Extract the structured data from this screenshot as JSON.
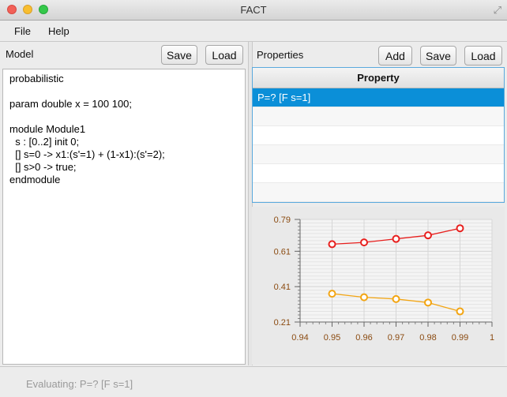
{
  "window": {
    "title": "FACT"
  },
  "menu": {
    "file": "File",
    "help": "Help"
  },
  "model": {
    "label": "Model",
    "save": "Save",
    "load": "Load",
    "code": "probabilistic\n\nparam double x = 100 100;\n\nmodule Module1\n  s : [0..2] init 0;\n  [] s=0 -> x1:(s'=1) + (1-x1):(s'=2);\n  [] s>0 -> true;\nendmodule"
  },
  "properties": {
    "label": "Properties",
    "add": "Add",
    "save": "Save",
    "load": "Load",
    "column": "Property",
    "rows": [
      "P=? [F s=1]",
      "",
      "",
      "",
      "",
      ""
    ]
  },
  "status": {
    "text": "Evaluating: P=? [F s=1]"
  },
  "chart_data": {
    "type": "line",
    "x": [
      0.95,
      0.96,
      0.97,
      0.98,
      0.99
    ],
    "series": [
      {
        "values": [
          0.65,
          0.66,
          0.68,
          0.7,
          0.74
        ],
        "color": "#e8201e"
      },
      {
        "values": [
          0.37,
          0.35,
          0.34,
          0.32,
          0.27
        ],
        "color": "#f3a512"
      }
    ],
    "xlim": [
      0.94,
      1.0
    ],
    "ylim": [
      0.21,
      0.79
    ],
    "xticks": [
      "0.94",
      "0.95",
      "0.96",
      "0.97",
      "0.98",
      "0.99",
      "1"
    ],
    "yticks": [
      "0.21",
      "0.41",
      "0.61",
      "0.79"
    ],
    "grid": true
  }
}
